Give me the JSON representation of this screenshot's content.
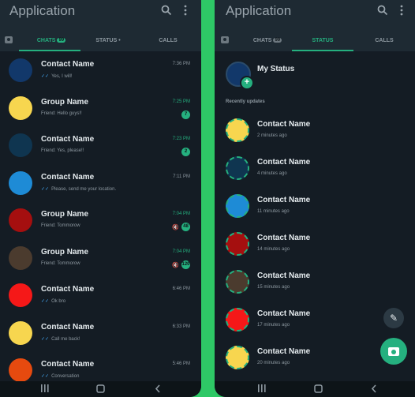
{
  "colors": {
    "accent": "#25b07f",
    "background": "#141c24",
    "header": "#1e2a33",
    "divider": "#2ec866"
  },
  "left": {
    "title": "Application",
    "tabs": [
      {
        "label": "CHATS",
        "badge": "99"
      },
      {
        "label": "STATUS •"
      },
      {
        "label": "CALLS"
      }
    ],
    "chats": [
      {
        "name": "Contact Name",
        "message": "Yes, I will!",
        "time": "7:36 PM",
        "avatar_color": "#12386a",
        "ticks": true,
        "unread": "",
        "muted": false
      },
      {
        "name": "Group Name",
        "message": "Friend: Hello guys!!",
        "time": "7:25 PM",
        "avatar_color": "#f7d64f",
        "ticks": false,
        "unread": "7",
        "muted": false
      },
      {
        "name": "Contact Name",
        "message": "Friend: Yes, please!!",
        "time": "7:23 PM",
        "avatar_color": "#0f3550",
        "ticks": false,
        "unread": "2",
        "muted": false
      },
      {
        "name": "Contact Name",
        "message": "Please, send me your location.",
        "time": "7:11 PM",
        "avatar_color": "#1e8bd6",
        "ticks": true,
        "unread": "",
        "muted": false
      },
      {
        "name": "Group Name",
        "message": "Friend: Tommorow",
        "time": "7:04 PM",
        "avatar_color": "#a50f0f",
        "ticks": false,
        "unread": "48",
        "muted": true
      },
      {
        "name": "Group Name",
        "message": "Friend: Tommorow",
        "time": "7:04 PM",
        "avatar_color": "#4b3b2e",
        "ticks": false,
        "unread": "120",
        "muted": true
      },
      {
        "name": "Contact Name",
        "message": "Ok bro",
        "time": "6:46 PM",
        "avatar_color": "#f51818",
        "ticks": true,
        "unread": "",
        "muted": false
      },
      {
        "name": "Contact Name",
        "message": "Call me back!",
        "time": "6:33 PM",
        "avatar_color": "#f7d64f",
        "ticks": true,
        "unread": "",
        "muted": false
      },
      {
        "name": "Contact Name",
        "message": "Conversation",
        "time": "5:46 PM",
        "avatar_color": "#e64a0f",
        "ticks": true,
        "unread": "",
        "muted": false
      }
    ]
  },
  "right": {
    "title": "Application",
    "tabs": [
      {
        "label": "CHATS",
        "badge": "99"
      },
      {
        "label": "STATUS"
      },
      {
        "label": "CALLS"
      }
    ],
    "my_status": "My Status",
    "section_label": "Recently updates",
    "statuses": [
      {
        "name": "Contact Name",
        "time": "2 minutes ago",
        "avatar_color": "#f7d64f"
      },
      {
        "name": "Contact Name",
        "time": "4 minutes ago",
        "avatar_color": "#0f3550"
      },
      {
        "name": "Contact Name",
        "time": "11 minutes ago",
        "avatar_color": "#1e8bd6"
      },
      {
        "name": "Contact Name",
        "time": "14 minutes ago",
        "avatar_color": "#a50f0f"
      },
      {
        "name": "Contact Name",
        "time": "15 minutes ago",
        "avatar_color": "#4b3b2e"
      },
      {
        "name": "Contact Name",
        "time": "17 minutes ago",
        "avatar_color": "#f51818"
      },
      {
        "name": "Contact Name",
        "time": "20 minutes ago",
        "avatar_color": "#f7d64f"
      }
    ]
  },
  "icons": {
    "search": "search-icon",
    "menu": "more-vert-icon",
    "camera": "camera-icon",
    "pencil": "pencil-icon",
    "mute": "mute-icon",
    "nav_recents": "recents-icon",
    "nav_home": "home-icon",
    "nav_back": "back-icon"
  }
}
